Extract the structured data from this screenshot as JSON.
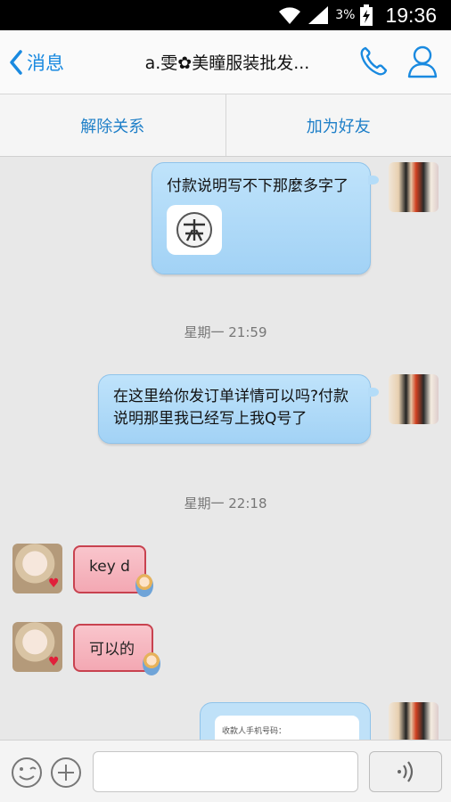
{
  "status_bar": {
    "battery_percent": "3%",
    "time": "19:36"
  },
  "nav": {
    "back_label": "消息",
    "title": "a.雯✿美瞳服装批发..."
  },
  "actions": {
    "unfriend": "解除关系",
    "add_friend": "加为好友"
  },
  "messages": {
    "m1_text": "付款说明写不下那麼多字了",
    "ts1": "星期一 21:59",
    "m2_text": "在这里给你发订单详情可以吗?付款说明那里我已经写上我Q号了",
    "ts2": "星期一 22:18",
    "m3_text": "key d",
    "m4_text": "可以的",
    "m5_snippet": "收款人手机号码："
  },
  "input": {
    "placeholder": ""
  },
  "colors": {
    "accent": "#1a8ae0",
    "bubble_self": "#a9d6f7",
    "bubble_other": "#f4aab5"
  }
}
